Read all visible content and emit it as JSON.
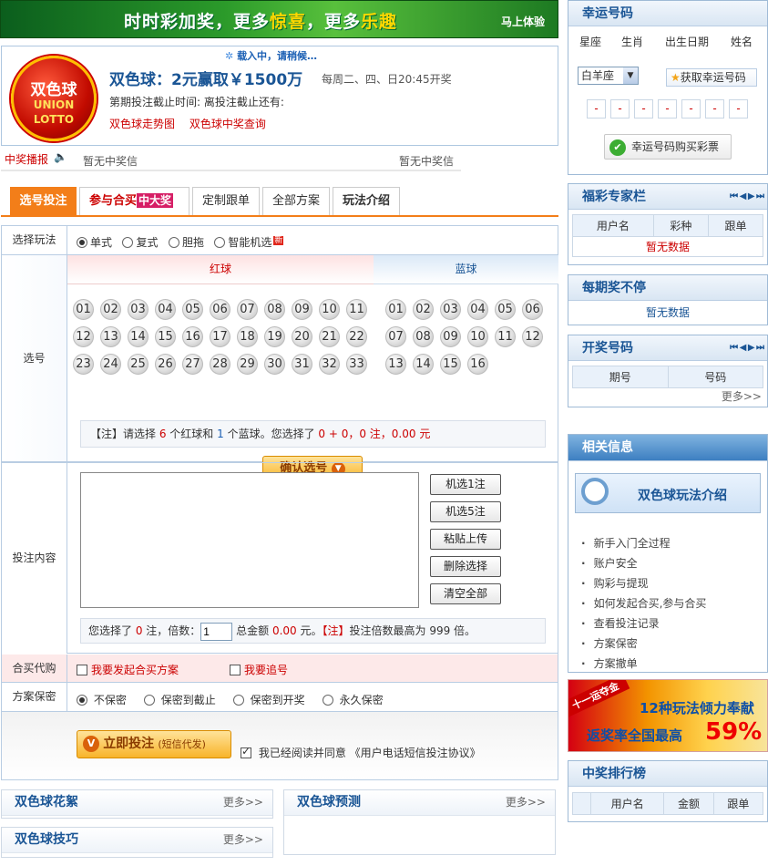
{
  "banner": {
    "slogan_a": "时时彩加奖，更多",
    "slogan_b": "惊喜",
    "slogan_c": "，更多",
    "slogan_d": "乐趣",
    "try": "马上体验"
  },
  "lottery": {
    "loading": "载入中，请稍候…",
    "logo_cn": "双色球",
    "logo_en1": "UNION",
    "logo_en2": "LOTTO",
    "title": "双色球：2元赢取￥1500万",
    "days": "每周二、四、日20:45开奖",
    "deadline": "第期投注截止时间: 离投注截止还有:",
    "links": [
      "双色球走势图",
      "双色球中奖查询"
    ]
  },
  "broadcast": {
    "label": "中奖播报",
    "msg1": "暂无中奖信",
    "msg2": "暂无中奖信"
  },
  "tabs": [
    {
      "label": "选号投注"
    },
    {
      "label": "参与合买",
      "badge": "中大奖"
    },
    {
      "label": "定制跟单"
    },
    {
      "label": "全部方案"
    },
    {
      "label": "玩法介绍"
    }
  ],
  "form": {
    "play_label": "选择玩法",
    "play_options": [
      "单式",
      "复式",
      "胆拖",
      "智能机选"
    ],
    "new_badge": "新",
    "pick_label": "选号",
    "red_header": "红球",
    "blue_header": "蓝球",
    "red_balls": [
      "01",
      "02",
      "03",
      "04",
      "05",
      "06",
      "07",
      "08",
      "09",
      "10",
      "11",
      "12",
      "13",
      "14",
      "15",
      "16",
      "17",
      "18",
      "19",
      "20",
      "21",
      "22",
      "23",
      "24",
      "25",
      "26",
      "27",
      "28",
      "29",
      "30",
      "31",
      "32",
      "33"
    ],
    "blue_balls": [
      "01",
      "02",
      "03",
      "04",
      "05",
      "06",
      "07",
      "08",
      "09",
      "10",
      "11",
      "12",
      "13",
      "14",
      "15",
      "16"
    ],
    "note_a": "【注】请选择 ",
    "note_red_n": "6",
    "note_b": " 个红球和 ",
    "note_blue_n": "1",
    "note_c": " 个蓝球。您选择了 ",
    "note_sel": "0 + 0，0 注，0.00 元",
    "confirm": "确认选号",
    "content_label": "投注内容",
    "buttons": [
      "机选1注",
      "机选5注",
      "粘贴上传",
      "删除选择",
      "清空全部"
    ],
    "sum_a": "您选择了 ",
    "sum_count": "0",
    "sum_b": " 注，倍数：",
    "multiple": "1",
    "sum_c": " 总金额 ",
    "sum_amount": "0.00",
    "sum_d": " 元。",
    "sum_note": "【注】",
    "sum_e": "投注倍数最高为 999 倍。",
    "group_label": "合买代购",
    "group_opt1": "我要发起合买方案",
    "group_opt2": "我要追号",
    "secret_label": "方案保密",
    "secret_opts": [
      "不保密",
      "保密到截止",
      "保密到开奖",
      "永久保密"
    ],
    "submit_main": "立即投注",
    "submit_sub": "(短信代发)",
    "agree": "我已经阅读并同意 《用户电话短信投注协议》"
  },
  "bottom": {
    "p1": "双色球花絮",
    "p2": "双色球预测",
    "p3": "双色球技巧",
    "more": "更多>>"
  },
  "sidebar": {
    "lucky": {
      "title": "幸运号码",
      "tabs": [
        "星座",
        "生肖",
        "出生日期",
        "姓名"
      ],
      "select": "白羊座",
      "get_btn": "获取幸运号码",
      "boxes": [
        "-",
        "-",
        "-",
        "-",
        "-",
        "-",
        "-"
      ],
      "buy_btn": "幸运号码购买彩票"
    },
    "expert": {
      "title": "福彩专家栏",
      "cols": [
        "用户名",
        "彩种",
        "跟单"
      ],
      "empty": "暂无数据"
    },
    "nonstop": {
      "title": "每期奖不停",
      "empty": "暂无数据"
    },
    "draw": {
      "title": "开奖号码",
      "cols": [
        "期号",
        "号码"
      ],
      "more": "更多>>"
    },
    "related": {
      "title": "相关信息",
      "promo": "双色球玩法介绍",
      "items": [
        "新手入门全过程",
        "账户安全",
        "购彩与提现",
        "如何发起合买,参与合买",
        "查看投注记录",
        "方案保密",
        "方案撤单"
      ]
    },
    "ad": {
      "badge": "十一运夺金",
      "line1": "12种玩法倾力奉献",
      "line2": "返奖率全国最高",
      "pct": "59%"
    },
    "rank": {
      "title": "中奖排行榜",
      "cols": [
        "",
        "用户名",
        "金额",
        "跟单"
      ]
    }
  }
}
